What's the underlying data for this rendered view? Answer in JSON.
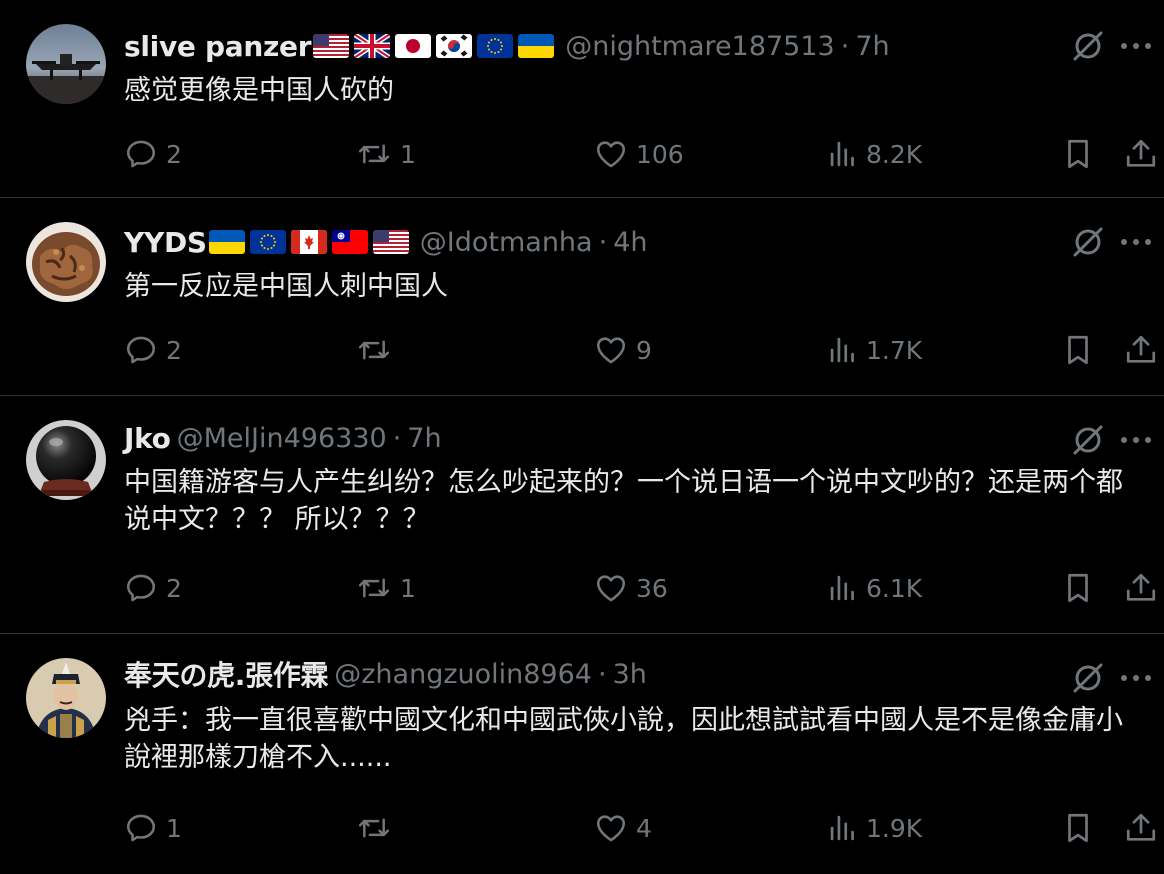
{
  "colors": {
    "background": "#000000",
    "text_primary": "#e7e9ea",
    "text_secondary": "#71767b",
    "divider": "#2f3336"
  },
  "tweets": [
    {
      "name": "slive panzer",
      "flags": [
        "us-flag",
        "uk-flag",
        "japan-flag",
        "south-korea-flag",
        "eu-flag",
        "ukraine-flag"
      ],
      "handle": "@nightmare187513",
      "separator": "·",
      "time": "7h",
      "text": "感觉更像是中国人砍的",
      "replies": "2",
      "retweets": "1",
      "likes": "106",
      "views": "8.2K",
      "avatar_icon": "drone-photo-avatar"
    },
    {
      "name": "YYDS",
      "flags": [
        "ukraine-flag",
        "eu-flag",
        "canada-flag",
        "taiwan-flag",
        "us-flag"
      ],
      "handle": "@Idotmanha",
      "separator": "·",
      "time": "4h",
      "text": "第一反应是中国人刺中国人",
      "replies": "2",
      "retweets": "",
      "likes": "9",
      "views": "1.7K",
      "avatar_icon": "walnut-carving-avatar"
    },
    {
      "name": "Jko",
      "flags": [],
      "handle": "@MelJin496330",
      "separator": "·",
      "time": "7h",
      "text": "中国籍游客与人产生纠纷？怎么吵起来的？一个说日语一个说中文吵的？还是两个都说中文？？？ 所以？？？",
      "replies": "2",
      "retweets": "1",
      "likes": "36",
      "views": "6.1K",
      "avatar_icon": "crystal-ball-avatar"
    },
    {
      "name": "奉天の虎.張作霖",
      "flags": [],
      "handle": "@zhangzuolin8964",
      "separator": "·",
      "time": "3h",
      "text": "兇手：我一直很喜歡中國文化和中國武俠小說，因此想試試看中國人是不是像金庸小說裡那樣刀槍不入......",
      "replies": "1",
      "retweets": "",
      "likes": "4",
      "views": "1.9K",
      "avatar_icon": "portrait-avatar"
    }
  ]
}
